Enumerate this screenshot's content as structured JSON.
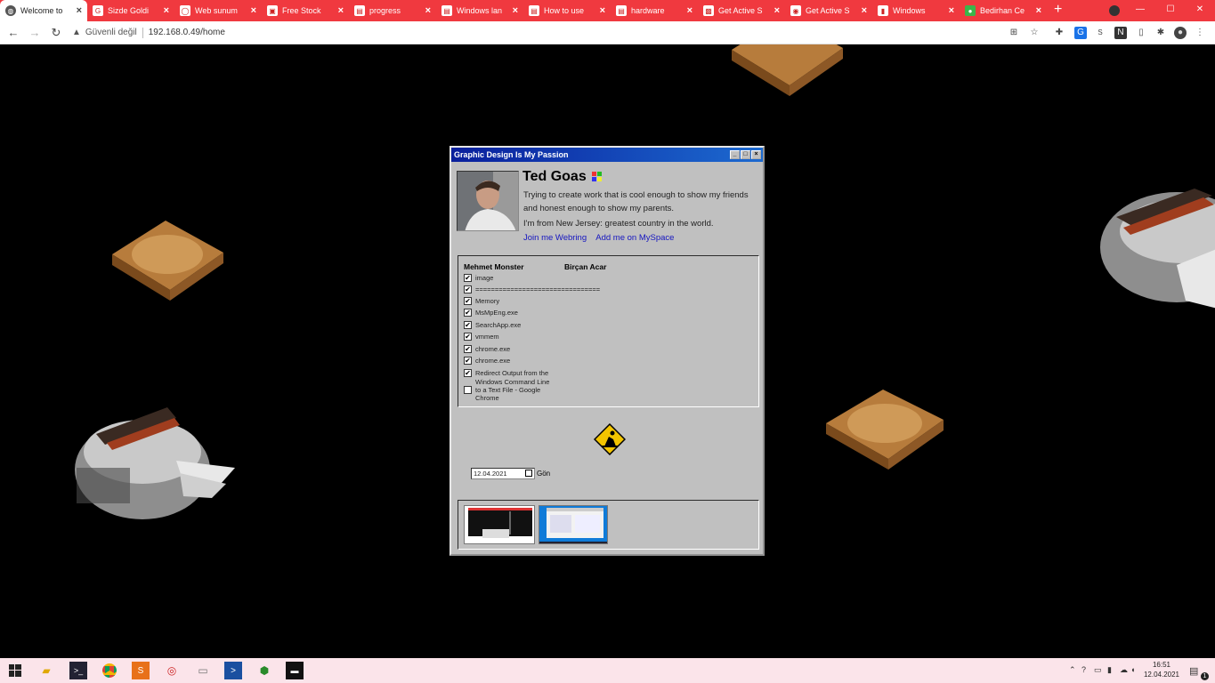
{
  "browser": {
    "tabs": [
      {
        "title": "Welcome to"
      },
      {
        "title": "Sizde Goldi"
      },
      {
        "title": "Web sunum"
      },
      {
        "title": "Free Stock"
      },
      {
        "title": "progress"
      },
      {
        "title": "Windows lan"
      },
      {
        "title": "How to use"
      },
      {
        "title": "hardware"
      },
      {
        "title": "Get Active S"
      },
      {
        "title": "Get Active S"
      },
      {
        "title": "Windows"
      },
      {
        "title": "Bedirhan Ce"
      }
    ],
    "new_tab": "+",
    "security": "Güvenli değil",
    "url": "192.168.0.49/home"
  },
  "window": {
    "title": "Graphic Design Is My Passion",
    "name": "Ted Goas",
    "bio1": "Trying to create work that is cool enough to show my friends and honest enough to show my parents.",
    "bio2": "I'm from New Jersey: greatest country in the world.",
    "link1": "Join me Webring",
    "link2": "Add me on MySpace",
    "col1": "Mehmet Monster",
    "col2": "Birçan Acar",
    "items": [
      {
        "label": "image",
        "checked": "✔"
      },
      {
        "label": "================================",
        "checked": "✔"
      },
      {
        "label": "Memory",
        "checked": "✔"
      },
      {
        "label": "MsMpEng.exe",
        "checked": "✔"
      },
      {
        "label": "SearchApp.exe",
        "checked": "✔"
      },
      {
        "label": "vmmem",
        "checked": "✔"
      },
      {
        "label": "chrome.exe",
        "checked": "✔"
      },
      {
        "label": "chrome.exe",
        "checked": "✔"
      },
      {
        "label": "Redirect Output from the",
        "checked": "✔"
      },
      {
        "label": "Windows Command Line to a Text File - Google Chrome",
        "checked": ""
      }
    ],
    "date": "12.04.2021",
    "send": "Gön"
  },
  "taskbar": {
    "time": "16:51",
    "date": "12.04.2021",
    "notif_count": "1"
  }
}
